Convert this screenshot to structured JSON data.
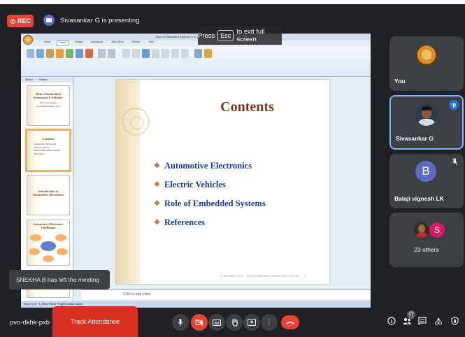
{
  "recording": {
    "label": "REC"
  },
  "presenter": {
    "text": "Sivasankar G is presenting"
  },
  "fullscreen_hint": {
    "before": "Press",
    "key": "Esc",
    "after": "to exit full screen"
  },
  "ppt": {
    "window_title": "Role of Embedded Systems in E-Vehicles - Microsoft PowerPoint",
    "ribbon_tabs": [
      "Home",
      "Insert",
      "Design",
      "Animations",
      "Slide Show",
      "Review",
      "View"
    ],
    "panel_tabs": [
      "Slides",
      "Outline"
    ],
    "thumbnails": [
      {
        "title": "Role of Embedded Systems in E-Vehicles",
        "lines": [
          "Dr. G. Sivasankar",
          "Associate Professor / EEE"
        ]
      },
      {
        "title": "Contents",
        "lines": [
          "Automotive Electronics",
          "Electric Vehicles",
          "Role of Embedded Systems",
          "References"
        ]
      },
      {
        "title": "Introduction to Automotive Electronics",
        "lines": []
      },
      {
        "title": "Automotive Electronic Challenges",
        "lines": []
      }
    ],
    "slide": {
      "title": "Contents",
      "bullets": [
        "Automotive Electronics",
        "Electric Vehicles",
        "Role of Embedded Systems",
        "References"
      ],
      "footer_date": "8 December 2021",
      "footer_title": "Role of Embedded Systems in E-Vehicles",
      "footer_page": "2"
    },
    "notes_placeholder": "Click to add notes",
    "status": "Slide 2 of 17    \"1_Office Theme\"    English (United States)"
  },
  "participants": [
    {
      "name": "You"
    },
    {
      "name": "Sivasankar G"
    },
    {
      "name": "Balaji vignesh LK",
      "initial": "B"
    },
    {
      "name": "23 others",
      "initial": "S"
    }
  ],
  "toast": {
    "text": "SNEKHA B has left the meeting"
  },
  "bottom": {
    "meeting_code": "pvo-dkhk-pxb",
    "track_attendance": "Track Attendance",
    "participant_count": "27"
  },
  "colors": {
    "rec": "#ea4335",
    "end_call": "#ea4335",
    "track": "#d93025",
    "slide_title": "#7a3914",
    "bullet_text": "#1b3e8f",
    "speaking": "#1a73e8"
  }
}
